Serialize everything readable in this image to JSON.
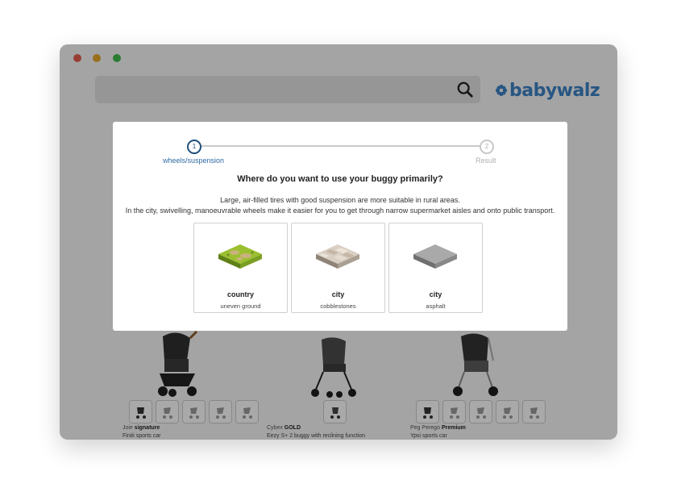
{
  "browser": {
    "dots": [
      "#e05b4f",
      "#e0a42a",
      "#3fb74a"
    ]
  },
  "header": {
    "logo_text": "babywalz",
    "logo_color": "#3a7fc1",
    "search_icon": "search-icon"
  },
  "products": [
    {
      "brand": "Joie",
      "line": "signature",
      "description": "Finiti sports car",
      "thumb_count": 5
    },
    {
      "brand": "Cybex",
      "line": "GOLD",
      "description": "Eezy S+ 2 buggy with reclining function",
      "thumb_count": 1
    },
    {
      "brand": "Peg Perego",
      "line": "Premium",
      "description": "Ypsi sports car",
      "thumb_count": 5
    }
  ],
  "wizard": {
    "steps": [
      {
        "number": "1",
        "label": "wheels/suspension",
        "state": "active"
      },
      {
        "number": "2",
        "label": "Result",
        "state": "inactive"
      }
    ],
    "question": "Where do you want to use your buggy primarily?",
    "explanation_line1": "Large, air-filled tires with good suspension are more suitable in rural areas.",
    "explanation_line2": "In the city, swivelling, manoeuvrable wheels make it easier for you to get through narrow supermarket aisles and onto public transport.",
    "options": [
      {
        "title": "country",
        "subtitle": "uneven ground",
        "icon": "grass-terrain-icon"
      },
      {
        "title": "city",
        "subtitle": "cobblestones",
        "icon": "cobblestone-terrain-icon"
      },
      {
        "title": "city",
        "subtitle": "asphalt",
        "icon": "asphalt-terrain-icon"
      }
    ]
  }
}
